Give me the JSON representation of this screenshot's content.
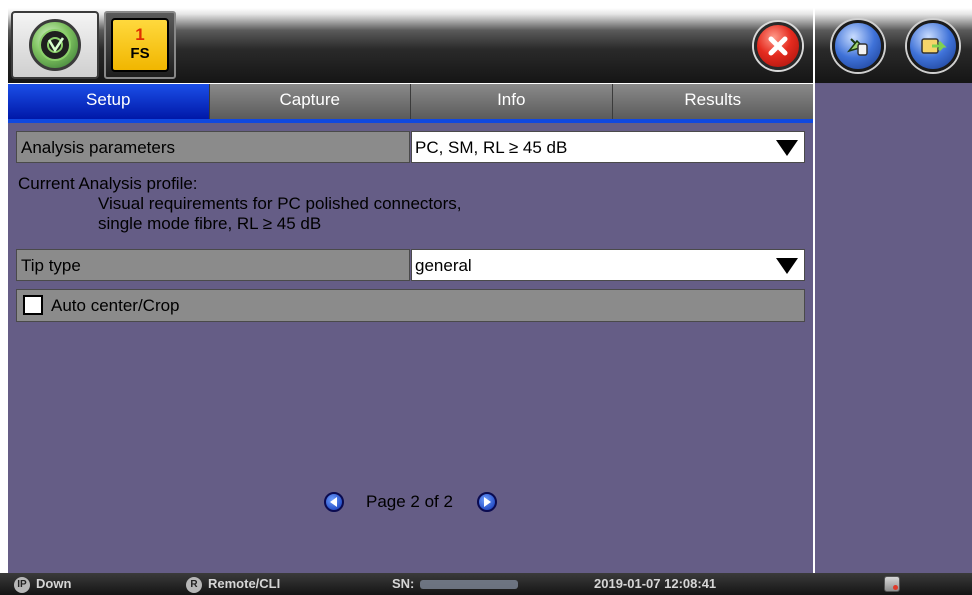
{
  "header": {
    "fs_number": "1",
    "fs_label": "FS"
  },
  "tabs": [
    {
      "label": "Setup",
      "active": true
    },
    {
      "label": "Capture",
      "active": false
    },
    {
      "label": "Info",
      "active": false
    },
    {
      "label": "Results",
      "active": false
    }
  ],
  "setup": {
    "analysis_parameters": {
      "label": "Analysis parameters",
      "value": "PC, SM, RL ≥ 45 dB"
    },
    "current_profile": {
      "heading": "Current Analysis profile:",
      "line1": "Visual requirements for PC polished connectors,",
      "line2": "single mode fibre, RL ≥ 45 dB"
    },
    "tip_type": {
      "label": "Tip type",
      "value": "general"
    },
    "auto_center": {
      "label": "Auto center/Crop",
      "checked": false
    }
  },
  "pagination": {
    "text": "Page 2 of 2"
  },
  "statusbar": {
    "ip_badge": "IP",
    "ip_status": "Down",
    "remote_badge": "R",
    "remote_label": "Remote/CLI",
    "sn_label": "SN:",
    "datetime": "2019-01-07  12:08:41"
  },
  "icons": {
    "home": "viavi-logo-icon",
    "close": "close-icon",
    "right1": "connect-icon",
    "right2": "save-to-usb-icon",
    "pager_prev": "chevron-left-icon",
    "pager_next": "chevron-right-icon"
  },
  "colors": {
    "panel_bg": "#655d86",
    "active_tab": "#0b2fd0",
    "field_bg": "#8b8b8b"
  }
}
